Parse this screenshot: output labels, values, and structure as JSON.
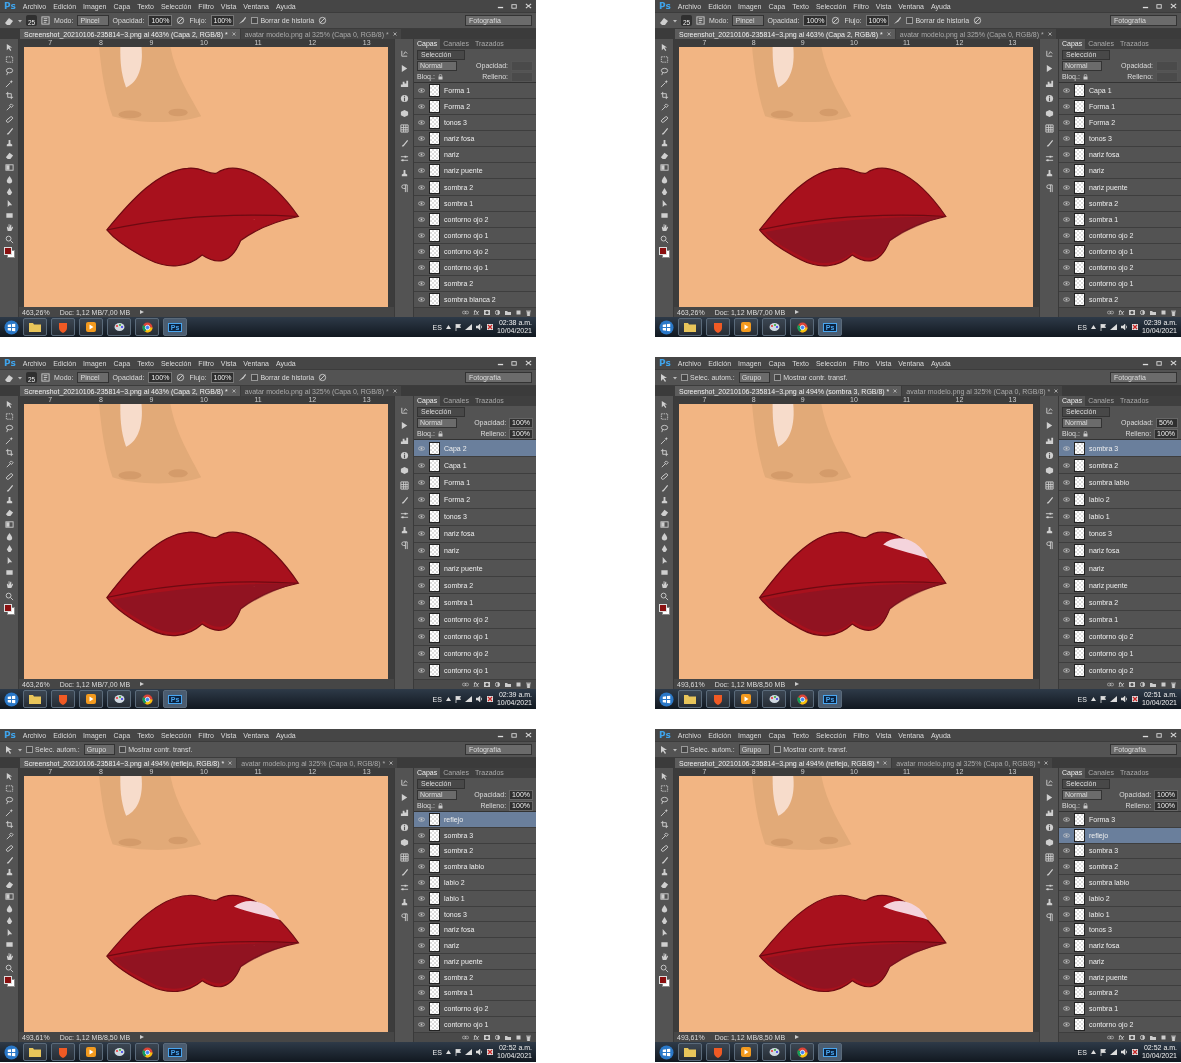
{
  "screens": [
    {
      "menu_bar": {
        "logo": "Ps",
        "items": [
          "Archivo",
          "Edición",
          "Imagen",
          "Capa",
          "Texto",
          "Selección",
          "Filtro",
          "Vista",
          "Ventana",
          "Ayuda"
        ]
      },
      "options_bar": {
        "kind": "brush",
        "brush_size": "25",
        "mode_label": "Modo:",
        "mode": "Pincel",
        "opacity_label": "Opacidad:",
        "opacity": "100%",
        "flow_label": "Flujo:",
        "flow": "100%",
        "history_label": "Borrar de historia",
        "history_checked": false,
        "workspace": "Fotografía"
      },
      "document_tabs": [
        {
          "label": "Screenshot_20210106-235814~3.png al 463% (Capa 2, RGB/8) *",
          "selected": true
        },
        {
          "label": "avatar modelo.png al 325% (Capa 0, RGB/8) *",
          "selected": false
        }
      ],
      "ruler_labels": [
        "7",
        "8",
        "9",
        "10",
        "11",
        "12",
        "13"
      ],
      "canvas": {
        "lower_lip_shade": false,
        "highlight": false
      },
      "status": {
        "zoom": "463,26%",
        "doc": "Doc: 1,12 MB/7,00 MB"
      },
      "layers_panel": {
        "tabs": [
          {
            "label": "Capas",
            "selected": true
          },
          {
            "label": "Canales",
            "selected": false
          },
          {
            "label": "Trazados",
            "selected": false
          }
        ],
        "filter": "Selección",
        "blend_mode": "Normal",
        "opacity_label": "Opacidad:",
        "lock_label": "Bloq.:",
        "fill_label": "Relleno:",
        "effects_button": "fx",
        "layers": [
          {
            "name": "Forma 1",
            "selected": false
          },
          {
            "name": "Forma 2",
            "selected": false
          },
          {
            "name": "tonos 3",
            "selected": false
          },
          {
            "name": "nariz fosa",
            "selected": false
          },
          {
            "name": "nariz",
            "selected": false
          },
          {
            "name": "nariz puente",
            "selected": false
          },
          {
            "name": "sombra 2",
            "selected": false
          },
          {
            "name": "sombra 1",
            "selected": false
          },
          {
            "name": "contorno ojo 2",
            "selected": false
          },
          {
            "name": "contorno ojo 1",
            "selected": false
          },
          {
            "name": "contorno ojo 2",
            "selected": false
          },
          {
            "name": "contorno ojo 1",
            "selected": false
          },
          {
            "name": "sombra 2",
            "selected": false
          },
          {
            "name": "sombra blanca 2",
            "selected": false
          }
        ]
      },
      "taskbar": {
        "app_label": "Ps",
        "language": "ES",
        "time": "02:38 a.m.",
        "date": "10/04/2021"
      }
    },
    {
      "menu_bar": {
        "logo": "Ps",
        "items": [
          "Archivo",
          "Edición",
          "Imagen",
          "Capa",
          "Texto",
          "Selección",
          "Filtro",
          "Vista",
          "Ventana",
          "Ayuda"
        ]
      },
      "options_bar": {
        "kind": "brush",
        "brush_size": "25",
        "mode_label": "Modo:",
        "mode": "Pincel",
        "opacity_label": "Opacidad:",
        "opacity": "100%",
        "flow_label": "Flujo:",
        "flow": "100%",
        "history_label": "Borrar de historia",
        "history_checked": false,
        "workspace": "Fotografía"
      },
      "document_tabs": [
        {
          "label": "Screenshot_20210106-235814~3.png al 463% (Capa 2, RGB/8) *",
          "selected": true
        },
        {
          "label": "avatar modelo.png al 325% (Capa 0, RGB/8) *",
          "selected": false
        }
      ],
      "ruler_labels": [
        "7",
        "8",
        "9",
        "10",
        "11",
        "12",
        "13"
      ],
      "canvas": {
        "lower_lip_shade": true,
        "highlight": false
      },
      "status": {
        "zoom": "463,26%",
        "doc": "Doc: 1,12 MB/7,00 MB"
      },
      "layers_panel": {
        "tabs": [
          {
            "label": "Capas",
            "selected": true
          },
          {
            "label": "Canales",
            "selected": false
          },
          {
            "label": "Trazados",
            "selected": false
          }
        ],
        "filter": "Selección",
        "blend_mode": "Normal",
        "opacity_label": "Opacidad:",
        "lock_label": "Bloq.:",
        "fill_label": "Relleno:",
        "effects_button": "fx",
        "layers": [
          {
            "name": "Capa 1",
            "selected": false
          },
          {
            "name": "Forma 1",
            "selected": false
          },
          {
            "name": "Forma 2",
            "selected": false
          },
          {
            "name": "tonos 3",
            "selected": false
          },
          {
            "name": "nariz fosa",
            "selected": false
          },
          {
            "name": "nariz",
            "selected": false
          },
          {
            "name": "nariz puente",
            "selected": false
          },
          {
            "name": "sombra 2",
            "selected": false
          },
          {
            "name": "sombra 1",
            "selected": false
          },
          {
            "name": "contorno ojo 2",
            "selected": false
          },
          {
            "name": "contorno ojo 1",
            "selected": false
          },
          {
            "name": "contorno ojo 2",
            "selected": false
          },
          {
            "name": "contorno ojo 1",
            "selected": false
          },
          {
            "name": "sombra 2",
            "selected": false
          }
        ]
      },
      "taskbar": {
        "app_label": "Ps",
        "language": "ES",
        "time": "02:39 a.m.",
        "date": "10/04/2021"
      }
    },
    {
      "menu_bar": {
        "logo": "Ps",
        "items": [
          "Archivo",
          "Edición",
          "Imagen",
          "Capa",
          "Texto",
          "Selección",
          "Filtro",
          "Vista",
          "Ventana",
          "Ayuda"
        ]
      },
      "options_bar": {
        "kind": "brush",
        "brush_size": "25",
        "mode_label": "Modo:",
        "mode": "Pincel",
        "opacity_label": "Opacidad:",
        "opacity": "100%",
        "flow_label": "Flujo:",
        "flow": "100%",
        "history_label": "Borrar de historia",
        "history_checked": false,
        "workspace": "Fotografía"
      },
      "document_tabs": [
        {
          "label": "Screenshot_20210106-235814~3.png al 463% (Capa 2, RGB/8) *",
          "selected": true
        },
        {
          "label": "avatar modelo.png al 325% (Capa 0, RGB/8) *",
          "selected": false
        }
      ],
      "ruler_labels": [
        "7",
        "8",
        "9",
        "10",
        "11",
        "12",
        "13"
      ],
      "canvas": {
        "lower_lip_shade": true,
        "highlight": false
      },
      "status": {
        "zoom": "463,26%",
        "doc": "Doc: 1,12 MB/7,00 MB"
      },
      "layers_panel": {
        "tabs": [
          {
            "label": "Capas",
            "selected": true
          },
          {
            "label": "Canales",
            "selected": false
          },
          {
            "label": "Trazados",
            "selected": false
          }
        ],
        "filter": "Selección",
        "blend_mode": "Normal",
        "opacity_label": "Opacidad:",
        "opacity": "100%",
        "lock_label": "Bloq.:",
        "fill_label": "Relleno:",
        "fill": "100%",
        "effects_button": "fx",
        "layers": [
          {
            "name": "Capa 2",
            "selected": true
          },
          {
            "name": "Capa 1",
            "selected": false
          },
          {
            "name": "Forma 1",
            "selected": false
          },
          {
            "name": "Forma 2",
            "selected": false
          },
          {
            "name": "tonos 3",
            "selected": false
          },
          {
            "name": "nariz fosa",
            "selected": false
          },
          {
            "name": "nariz",
            "selected": false
          },
          {
            "name": "nariz puente",
            "selected": false
          },
          {
            "name": "sombra 2",
            "selected": false
          },
          {
            "name": "sombra 1",
            "selected": false
          },
          {
            "name": "contorno ojo 2",
            "selected": false
          },
          {
            "name": "contorno ojo 1",
            "selected": false
          },
          {
            "name": "contorno ojo 2",
            "selected": false
          },
          {
            "name": "contorno ojo 1",
            "selected": false
          }
        ]
      },
      "taskbar": {
        "app_label": "Ps",
        "language": "ES",
        "time": "02:39 a.m.",
        "date": "10/04/2021"
      }
    },
    {
      "menu_bar": {
        "logo": "Ps",
        "items": [
          "Archivo",
          "Edición",
          "Imagen",
          "Capa",
          "Texto",
          "Selección",
          "Filtro",
          "Vista",
          "Ventana",
          "Ayuda"
        ]
      },
      "options_bar": {
        "kind": "move",
        "auto_select_label": "Selec. autom.:",
        "auto_select_checked": false,
        "auto_select": "Grupo",
        "transform_label": "Mostrar contr. transf.",
        "transform_checked": false,
        "workspace": "Fotografía"
      },
      "document_tabs": [
        {
          "label": "Screenshot_20210106-235814~3.png al 494% (sombra 3, RGB/8) *",
          "selected": true
        },
        {
          "label": "avatar modelo.png al 325% (Capa 0, RGB/8) *",
          "selected": false
        }
      ],
      "ruler_labels": [
        "7",
        "8",
        "9",
        "10",
        "11",
        "12",
        "13"
      ],
      "canvas": {
        "lower_lip_shade": true,
        "highlight": true
      },
      "status": {
        "zoom": "493,61%",
        "doc": "Doc: 1,12 MB/8,50 MB"
      },
      "layers_panel": {
        "tabs": [
          {
            "label": "Capas",
            "selected": true
          },
          {
            "label": "Canales",
            "selected": false
          },
          {
            "label": "Trazados",
            "selected": false
          }
        ],
        "filter": "Selección",
        "blend_mode": "Normal",
        "opacity_label": "Opacidad:",
        "opacity": "50%",
        "lock_label": "Bloq.:",
        "fill_label": "Relleno:",
        "fill": "100%",
        "effects_button": "fx",
        "layers": [
          {
            "name": "sombra 3",
            "selected": true
          },
          {
            "name": "sombra 2",
            "selected": false
          },
          {
            "name": "sombra labio",
            "selected": false
          },
          {
            "name": "labio 2",
            "selected": false
          },
          {
            "name": "labio 1",
            "selected": false
          },
          {
            "name": "tonos 3",
            "selected": false
          },
          {
            "name": "nariz fosa",
            "selected": false
          },
          {
            "name": "nariz",
            "selected": false
          },
          {
            "name": "nariz puente",
            "selected": false
          },
          {
            "name": "sombra 2",
            "selected": false
          },
          {
            "name": "sombra 1",
            "selected": false
          },
          {
            "name": "contorno ojo 2",
            "selected": false
          },
          {
            "name": "contorno ojo 1",
            "selected": false
          },
          {
            "name": "contorno ojo 2",
            "selected": false
          }
        ]
      },
      "taskbar": {
        "app_label": "Ps",
        "language": "ES",
        "time": "02:51 a.m.",
        "date": "10/04/2021"
      }
    },
    {
      "menu_bar": {
        "logo": "Ps",
        "items": [
          "Archivo",
          "Edición",
          "Imagen",
          "Capa",
          "Texto",
          "Selección",
          "Filtro",
          "Vista",
          "Ventana",
          "Ayuda"
        ]
      },
      "options_bar": {
        "kind": "move",
        "auto_select_label": "Selec. autom.:",
        "auto_select_checked": false,
        "auto_select": "Grupo",
        "transform_label": "Mostrar contr. transf.",
        "transform_checked": false,
        "workspace": "Fotografía"
      },
      "document_tabs": [
        {
          "label": "Screenshot_20210106-235814~3.png al 494% (reflejo, RGB/8) *",
          "selected": true
        },
        {
          "label": "avatar modelo.png al 325% (Capa 0, RGB/8) *",
          "selected": false
        }
      ],
      "ruler_labels": [
        "7",
        "8",
        "9",
        "10",
        "11",
        "12",
        "13"
      ],
      "canvas": {
        "lower_lip_shade": true,
        "highlight": true
      },
      "status": {
        "zoom": "493,61%",
        "doc": "Doc: 1,12 MB/8,50 MB"
      },
      "layers_panel": {
        "tabs": [
          {
            "label": "Capas",
            "selected": true
          },
          {
            "label": "Canales",
            "selected": false
          },
          {
            "label": "Trazados",
            "selected": false
          }
        ],
        "filter": "Selección",
        "blend_mode": "Normal",
        "opacity_label": "Opacidad:",
        "opacity": "100%",
        "lock_label": "Bloq.:",
        "fill_label": "Relleno:",
        "fill": "100%",
        "effects_button": "fx",
        "layers": [
          {
            "name": "reflejo",
            "selected": true
          },
          {
            "name": "sombra 3",
            "selected": false
          },
          {
            "name": "sombra 2",
            "selected": false
          },
          {
            "name": "sombra labio",
            "selected": false
          },
          {
            "name": "labio 2",
            "selected": false
          },
          {
            "name": "labio 1",
            "selected": false
          },
          {
            "name": "tonos 3",
            "selected": false
          },
          {
            "name": "nariz fosa",
            "selected": false
          },
          {
            "name": "nariz",
            "selected": false
          },
          {
            "name": "nariz puente",
            "selected": false
          },
          {
            "name": "sombra 2",
            "selected": false
          },
          {
            "name": "sombra 1",
            "selected": false
          },
          {
            "name": "contorno ojo 2",
            "selected": false
          },
          {
            "name": "contorno ojo 1",
            "selected": false
          }
        ]
      },
      "taskbar": {
        "app_label": "Ps",
        "language": "ES",
        "time": "02:52 a.m.",
        "date": "10/04/2021"
      }
    },
    {
      "menu_bar": {
        "logo": "Ps",
        "items": [
          "Archivo",
          "Edición",
          "Imagen",
          "Capa",
          "Texto",
          "Selección",
          "Filtro",
          "Vista",
          "Ventana",
          "Ayuda"
        ]
      },
      "options_bar": {
        "kind": "move",
        "auto_select_label": "Selec. autom.:",
        "auto_select_checked": false,
        "auto_select": "Grupo",
        "transform_label": "Mostrar contr. transf.",
        "transform_checked": false,
        "workspace": "Fotografía"
      },
      "document_tabs": [
        {
          "label": "Screenshot_20210106-235814~3.png al 494% (reflejo, RGB/8) *",
          "selected": true
        },
        {
          "label": "avatar modelo.png al 325% (Capa 0, RGB/8) *",
          "selected": false
        }
      ],
      "ruler_labels": [
        "7",
        "8",
        "9",
        "10",
        "11",
        "12",
        "13"
      ],
      "canvas": {
        "lower_lip_shade": true,
        "highlight": true
      },
      "status": {
        "zoom": "493,61%",
        "doc": "Doc: 1,12 MB/8,50 MB"
      },
      "layers_panel": {
        "tabs": [
          {
            "label": "Capas",
            "selected": true
          },
          {
            "label": "Canales",
            "selected": false
          },
          {
            "label": "Trazados",
            "selected": false
          }
        ],
        "filter": "Selección",
        "blend_mode": "Normal",
        "opacity_label": "Opacidad:",
        "opacity": "100%",
        "lock_label": "Bloq.:",
        "fill_label": "Relleno:",
        "fill": "100%",
        "effects_button": "fx",
        "layers": [
          {
            "name": "Forma 3",
            "selected": false
          },
          {
            "name": "reflejo",
            "selected": true
          },
          {
            "name": "sombra 3",
            "selected": false
          },
          {
            "name": "sombra 2",
            "selected": false
          },
          {
            "name": "sombra labio",
            "selected": false
          },
          {
            "name": "labio 2",
            "selected": false
          },
          {
            "name": "labio 1",
            "selected": false
          },
          {
            "name": "tonos 3",
            "selected": false
          },
          {
            "name": "nariz fosa",
            "selected": false
          },
          {
            "name": "nariz",
            "selected": false
          },
          {
            "name": "nariz puente",
            "selected": false
          },
          {
            "name": "sombra 2",
            "selected": false
          },
          {
            "name": "sombra 1",
            "selected": false
          },
          {
            "name": "contorno ojo 2",
            "selected": false
          }
        ]
      },
      "taskbar": {
        "app_label": "Ps",
        "language": "ES",
        "time": "02:52 a.m.",
        "date": "10/04/2021"
      }
    }
  ]
}
